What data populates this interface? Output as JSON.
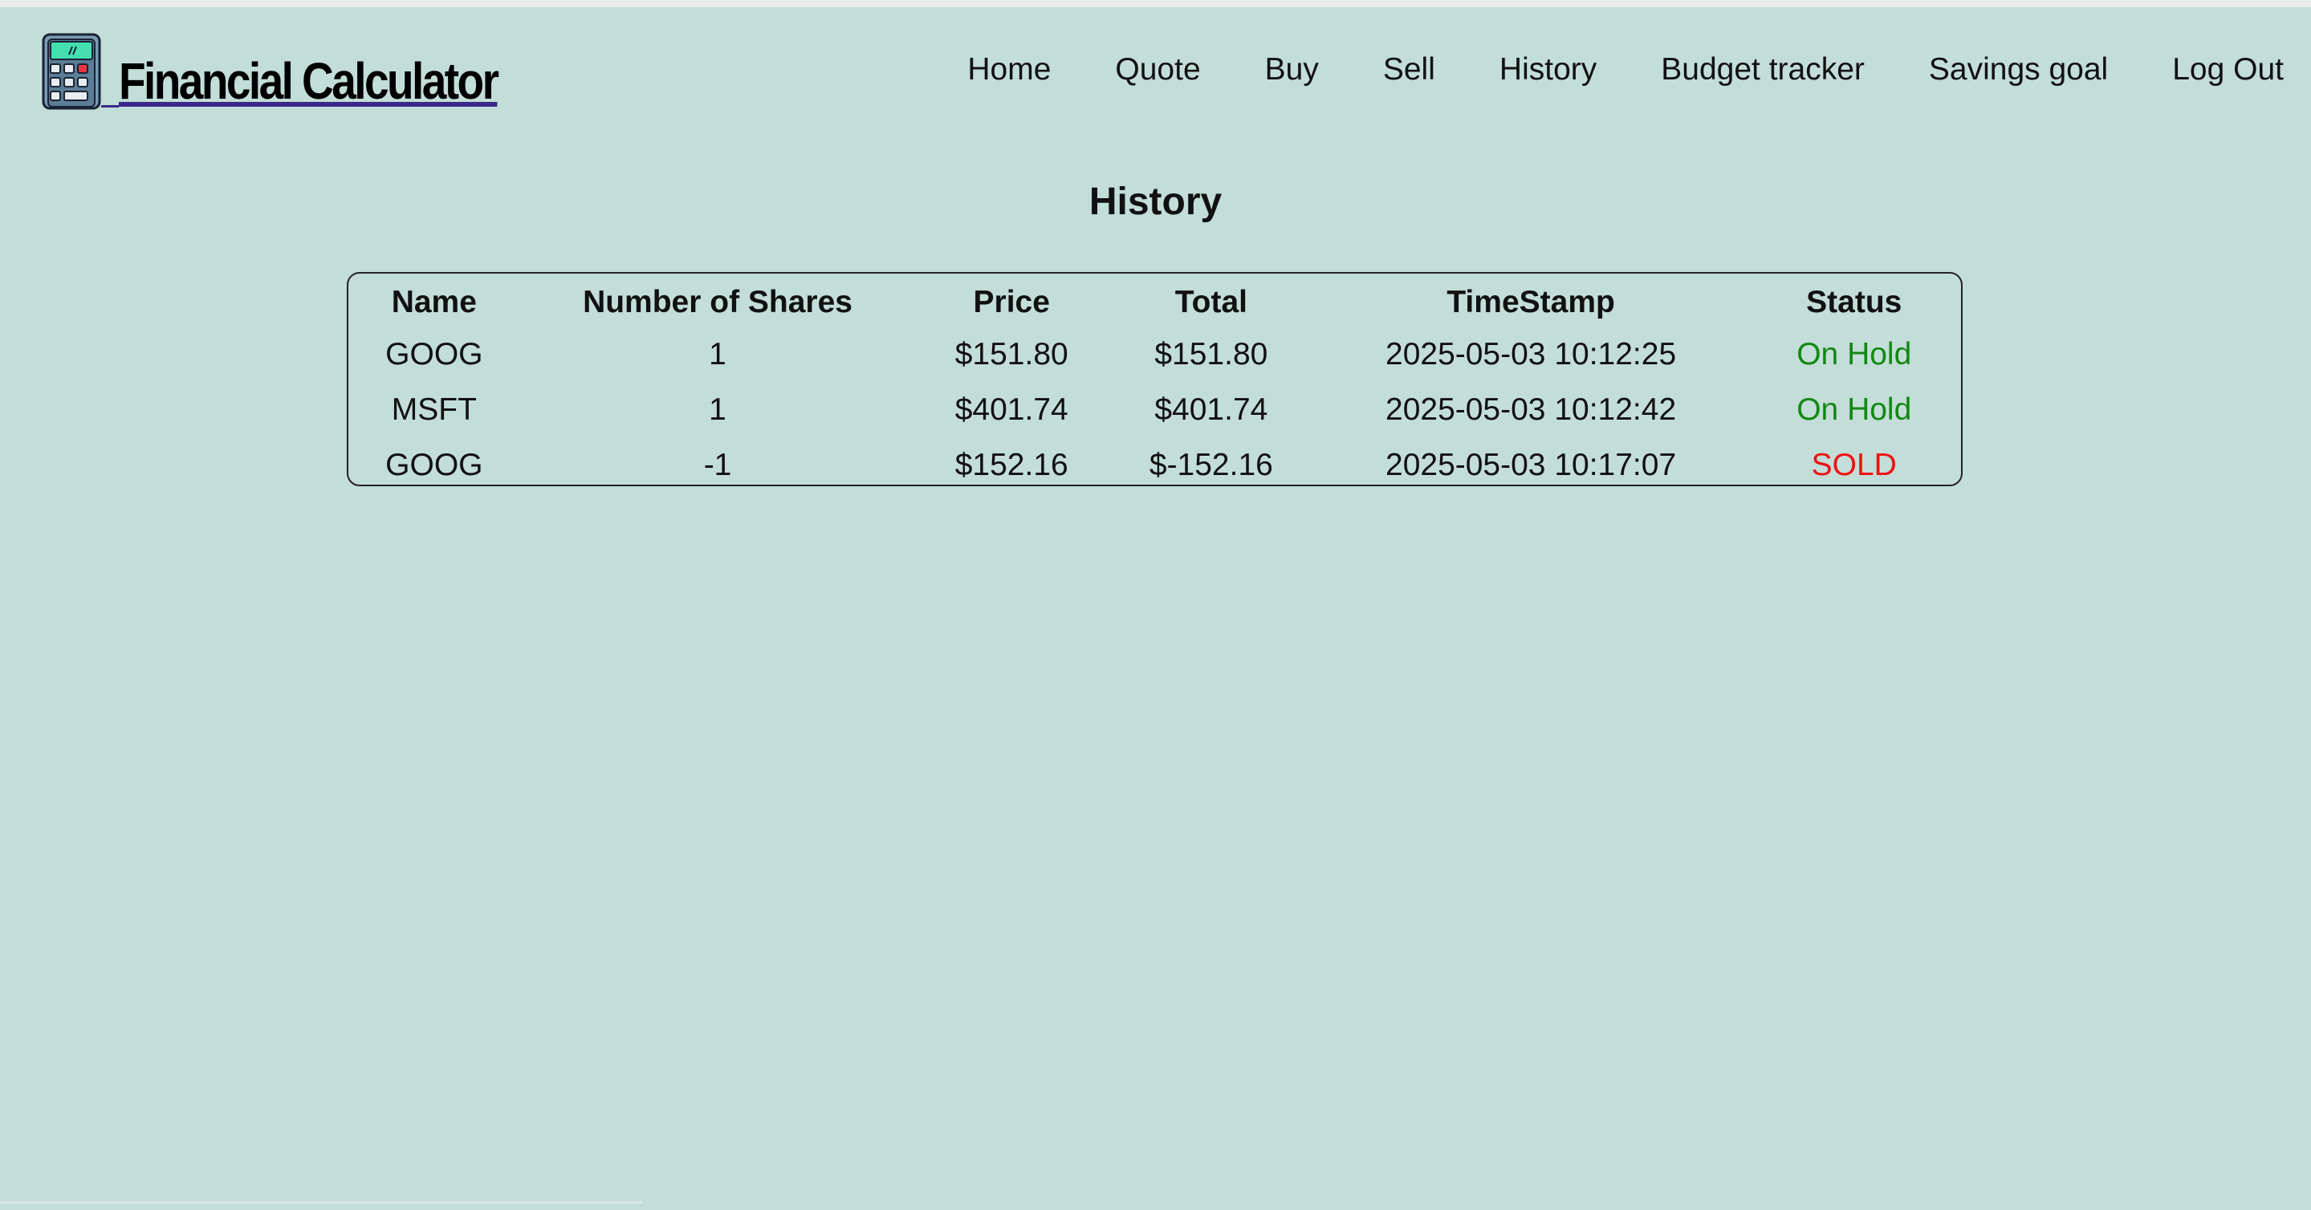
{
  "header": {
    "brand_title": "Financial Calculator",
    "logo_icon": "calculator-icon"
  },
  "nav": {
    "items": [
      {
        "label": "Home"
      },
      {
        "label": "Quote"
      },
      {
        "label": "Buy"
      },
      {
        "label": "Sell"
      },
      {
        "label": "History"
      },
      {
        "label": "Budget tracker"
      },
      {
        "label": "Savings goal"
      },
      {
        "label": "Log Out"
      }
    ]
  },
  "main": {
    "title": "History",
    "table": {
      "columns": [
        "Name",
        "Number of Shares",
        "Price",
        "Total",
        "TimeStamp",
        "Status"
      ],
      "rows": [
        {
          "name": "GOOG",
          "shares": "1",
          "price": "$151.80",
          "total": "$151.80",
          "timestamp": "2025-05-03 10:12:25",
          "status": "On Hold"
        },
        {
          "name": "MSFT",
          "shares": "1",
          "price": "$401.74",
          "total": "$401.74",
          "timestamp": "2025-05-03 10:12:42",
          "status": "On Hold"
        },
        {
          "name": "GOOG",
          "shares": "-1",
          "price": "$152.16",
          "total": "$-152.16",
          "timestamp": "2025-05-03 10:17:07",
          "status": "SOLD"
        }
      ]
    }
  },
  "colors": {
    "background": "#c3ddd8",
    "on_hold": "#118811",
    "sold": "#ee1111"
  }
}
